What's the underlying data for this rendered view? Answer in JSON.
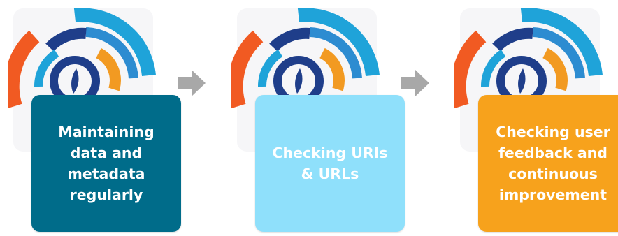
{
  "colors": {
    "card_1": "#006C8A",
    "card_2": "#8FE0FB",
    "card_3": "#F7A21C",
    "arrow": "#A8A8A8",
    "logo_outer_ring": "#1FA3D9",
    "logo_dark_blue": "#1F3E8A",
    "logo_mid_blue": "#2D8CD1",
    "logo_orange": "#F29A22",
    "logo_red_orange": "#F15A22"
  },
  "steps": [
    {
      "text": "Maintaining\ndata and\nmetadata\nregularly",
      "icon": "ring-logo-icon"
    },
    {
      "text": "Checking URIs\n& URLs",
      "icon": "ring-logo-icon"
    },
    {
      "text": "Checking user\nfeedback and\ncontinuous\nimprovement",
      "icon": "ring-logo-icon"
    }
  ],
  "arrows": [
    {
      "icon": "right-arrow-icon"
    },
    {
      "icon": "right-arrow-icon"
    }
  ]
}
